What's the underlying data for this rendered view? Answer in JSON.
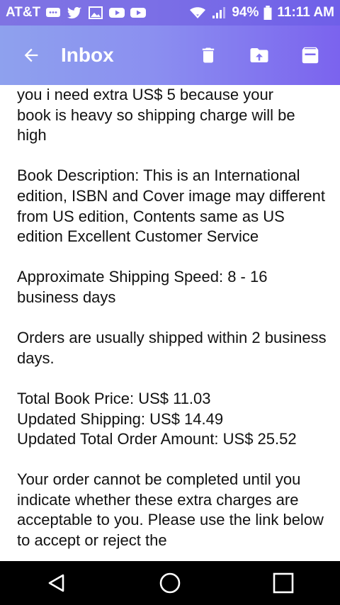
{
  "status_bar": {
    "carrier": "AT&T",
    "battery": "94%",
    "time": "11:11 AM",
    "icons": [
      "chat-icon",
      "twitter-icon",
      "image-icon",
      "youtube-icon",
      "youtube-icon",
      "wifi-icon",
      "signal-icon",
      "battery-icon"
    ]
  },
  "app_bar": {
    "title": "Inbox",
    "icons": [
      "back-arrow-icon",
      "delete-icon",
      "move-to-icon",
      "archive-icon"
    ]
  },
  "email": {
    "lines": [
      "you i need extra US$ 5 because your",
      "book is heavy so shipping charge will be",
      "high"
    ],
    "description": "Book Description: This is an International edition, ISBN and Cover image may different from US edition, Contents same as US edition Excellent Customer Service",
    "shipping_speed": "Approximate Shipping Speed: 8 - 16 business days",
    "ship_within": "Orders are usually shipped within 2 business days.",
    "total_book_price": "Total Book Price: US$ 11.03",
    "updated_shipping": "Updated Shipping: US$ 14.49",
    "updated_total": "Updated Total Order Amount: US$ 25.52",
    "footer": "Your order cannot be completed until you indicate whether these extra charges are acceptable to you. Please use the link below to accept or reject the"
  },
  "nav_bar": {
    "icons": [
      "back-triangle-icon",
      "home-circle-icon",
      "recents-square-icon"
    ]
  }
}
